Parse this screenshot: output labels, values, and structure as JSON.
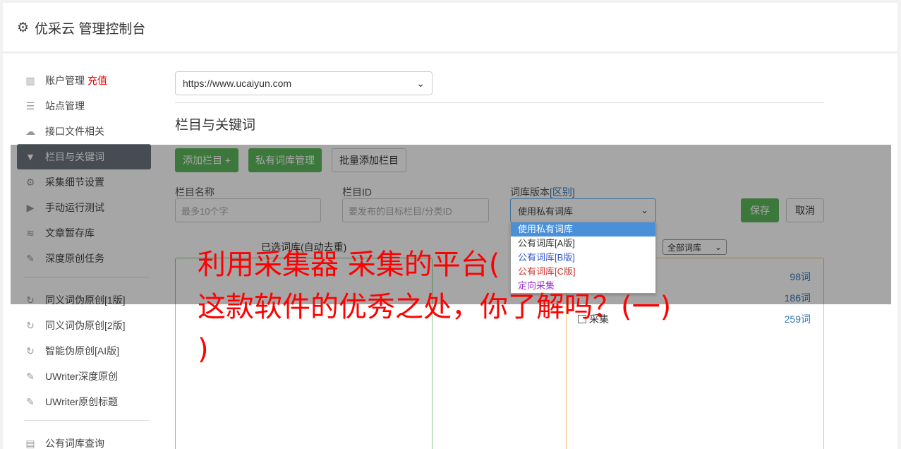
{
  "header": {
    "title": "优采云 管理控制台",
    "icon": "gear-icon"
  },
  "sidebar": {
    "items": [
      {
        "label": "账户管理",
        "icon": "bar-chart-icon",
        "badge": "充值"
      },
      {
        "label": "站点管理",
        "icon": "server-icon"
      },
      {
        "label": "接口文件相关",
        "icon": "cloud-upload-icon"
      },
      {
        "label": "栏目与关键词",
        "icon": "filter-icon",
        "active": true
      },
      {
        "label": "采集细节设置",
        "icon": "gears-icon"
      },
      {
        "label": "手动运行测试",
        "icon": "play-icon"
      },
      {
        "label": "文章暂存库",
        "icon": "database-icon"
      },
      {
        "label": "深度原创任务",
        "icon": "edit-icon"
      }
    ],
    "items2": [
      {
        "label": "同义词伪原创[1版]",
        "icon": "refresh-icon"
      },
      {
        "label": "同义词伪原创[2版]",
        "icon": "refresh-icon"
      },
      {
        "label": "智能伪原创[AI版]",
        "icon": "refresh-icon"
      },
      {
        "label": "UWriter深度原创",
        "icon": "edit-icon"
      },
      {
        "label": "UWriter原创标题",
        "icon": "edit-icon"
      }
    ],
    "items3": [
      {
        "label": "公有词库查询",
        "icon": "book-icon"
      }
    ]
  },
  "main": {
    "site_select": "https://www.ucaiyun.com",
    "section_title": "栏目与关键词",
    "buttons": {
      "add_column": "添加栏目 +",
      "private_lib": "私有词库管理",
      "batch_add": "批量添加栏目",
      "save": "保存",
      "cancel": "取消"
    },
    "form": {
      "name_label": "栏目名称",
      "name_placeholder": "最多10个字",
      "id_label": "栏目ID",
      "id_placeholder": "要发布的目标栏目/分类ID",
      "version_label": "词库版本",
      "version_link": "[区别]",
      "version_value": "使用私有词库"
    },
    "dropdown_options": [
      "使用私有词库",
      "公有词库[A版]",
      "公有词库[B版]",
      "公有词库[C版]",
      "定向采集"
    ],
    "selected_caption": "已选词库(自动去重)",
    "filter_select": "全部词库",
    "libraries": [
      {
        "name": "",
        "count": "98词"
      },
      {
        "name": "",
        "count": "186词"
      },
      {
        "name": "采集",
        "count": "259词"
      }
    ]
  },
  "headline": {
    "line1": "利用采集器 采集的平台(",
    "line2": "这款软件的优秀之处，你了解吗？(一)",
    "line3": ")"
  },
  "colors": {
    "accent_green": "#5cb85c",
    "active_nav": "#6c757d",
    "headline_red": "#ff0000"
  }
}
